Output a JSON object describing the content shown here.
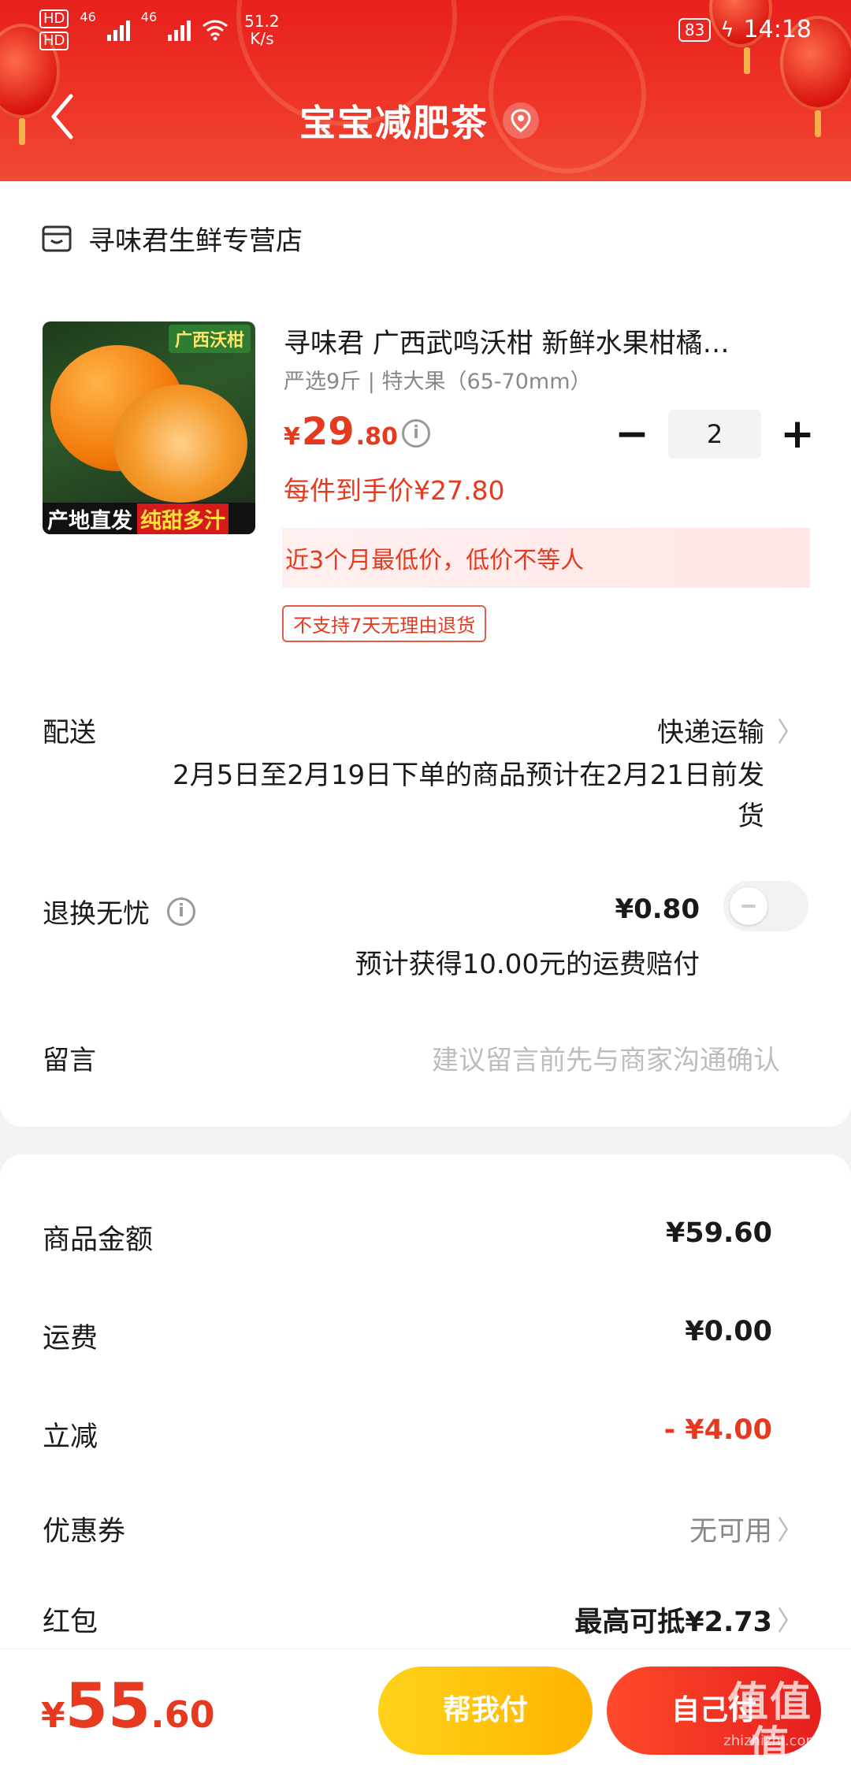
{
  "status_bar": {
    "hd1": "HD",
    "hd2": "HD",
    "net1": "46",
    "net2": "46",
    "speed_value": "51.2",
    "speed_unit": "K/s",
    "battery": "83",
    "time": "14:18"
  },
  "nav": {
    "title": "宝宝减肥茶"
  },
  "store": {
    "name": "寻味君生鲜专营店"
  },
  "product": {
    "title": "寻味君 广西武鸣沃柑 新鲜水果柑橘…",
    "spec": "严选9斤 | 特大果（65-70mm）",
    "price_symbol": "¥",
    "price_int": "29",
    "price_dec": ".80",
    "unit_price": "每件到手价¥27.80",
    "quantity": "2",
    "lowest_price_note": "近3个月最低价，低价不等人",
    "no_return_tag": "不支持7天无理由退货",
    "image_top_label": "广西沃柑",
    "image_bottom_left": "产地直发",
    "image_bottom_right": "纯甜多汁"
  },
  "shipping": {
    "label": "配送",
    "method": "快递运输",
    "note": "2月5日至2月19日下单的商品预计在2月21日前发货"
  },
  "return_insurance": {
    "label": "退换无忧",
    "price": "¥0.80",
    "note": "预计获得10.00元的运费赔付",
    "enabled": false
  },
  "message": {
    "label": "留言",
    "placeholder": "建议留言前先与商家沟通确认"
  },
  "summary": {
    "goods_amount_label": "商品金额",
    "goods_amount": "¥59.60",
    "freight_label": "运费",
    "freight": "¥0.00",
    "discount_label": "立减",
    "discount": "- ¥4.00",
    "coupon_label": "优惠券",
    "coupon": "无可用",
    "redpacket_label": "红包",
    "redpacket": "最高可抵¥2.73"
  },
  "footer": {
    "total_symbol": "¥",
    "total_int": "55",
    "total_dec": ".60",
    "help_pay": "帮我付",
    "self_pay": "自己付",
    "watermark": "值值值",
    "watermark_sub": "zhizhizhi.com"
  },
  "colors": {
    "header_red": "#e8201d",
    "price_red": "#e53a1f",
    "help_button": "#ffc20a",
    "self_button": "#f2321f"
  }
}
